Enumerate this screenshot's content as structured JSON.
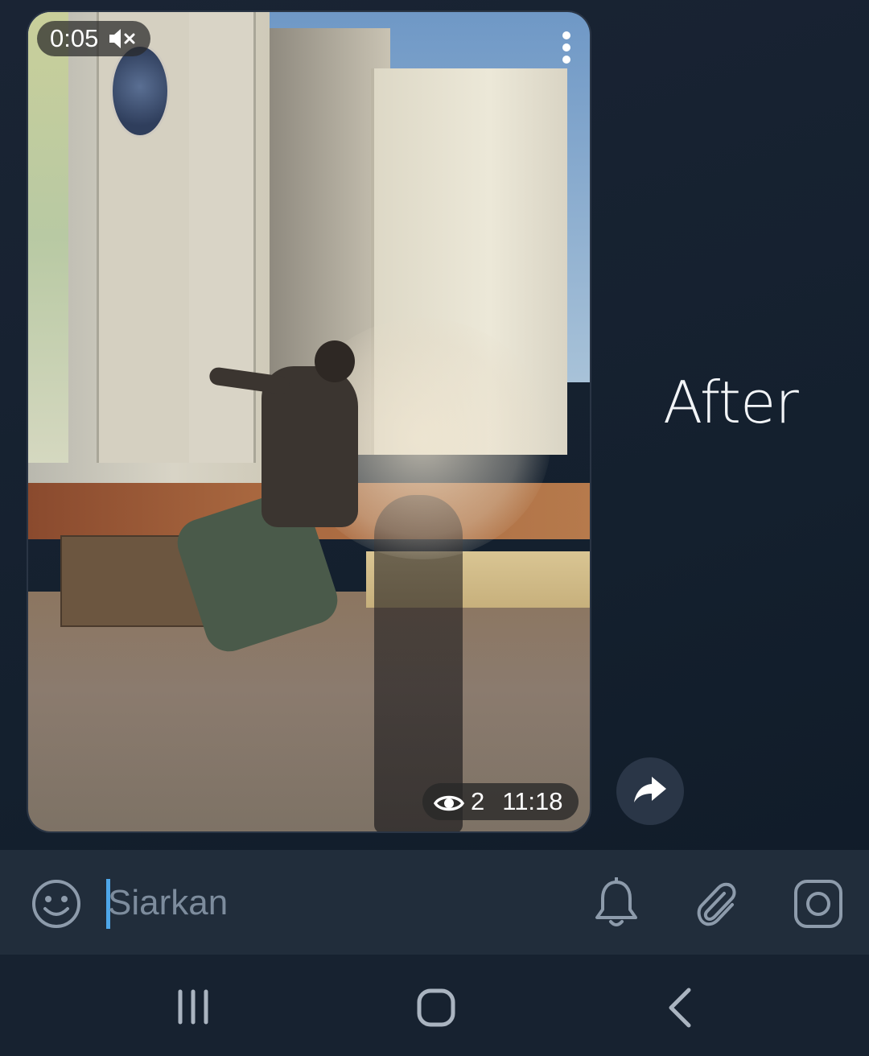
{
  "video": {
    "duration_label": "0:05",
    "mute_icon": "speaker-muted-icon",
    "more_icon": "three-dots-vertical-icon",
    "views": "2",
    "time": "11:18",
    "views_icon": "eye-icon"
  },
  "message": {
    "side_text": "After"
  },
  "actions": {
    "forward_icon": "share-forward-icon"
  },
  "input_bar": {
    "placeholder": "Siarkan",
    "value": "",
    "emoji_icon": "smiley-icon",
    "bell_icon": "bell-icon",
    "attach_icon": "paperclip-icon",
    "camera_icon": "instagram-camera-icon"
  },
  "nav_bar": {
    "recents_icon": "recents-icon",
    "home_icon": "home-icon",
    "back_icon": "back-chevron-icon"
  },
  "colors": {
    "background": "#172230",
    "input_bar": "#212d3b",
    "caret": "#4ea6e8",
    "icon_gray": "#8d9bab"
  }
}
